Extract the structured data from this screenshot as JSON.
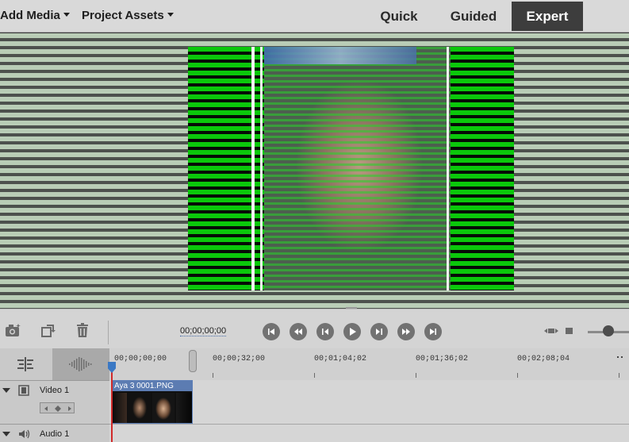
{
  "header": {
    "menus": [
      {
        "label": "Add Media"
      },
      {
        "label": "Project Assets"
      }
    ],
    "modes": [
      {
        "label": "Quick",
        "active": false
      },
      {
        "label": "Guided",
        "active": false
      },
      {
        "label": "Expert",
        "active": true
      }
    ]
  },
  "controls": {
    "timecode": "00;00;00;00",
    "transport_icons": [
      "go-to-start-icon",
      "rewind-icon",
      "step-back-icon",
      "play-icon",
      "step-forward-icon",
      "fast-forward-icon",
      "go-to-end-icon"
    ]
  },
  "timeline": {
    "ruler_labels": [
      "00;00;00;00",
      "00;00;32;00",
      "00;01;04;02",
      "00;01;36;02",
      "00;02;08;04"
    ],
    "tracks": [
      {
        "label": "Video 1"
      },
      {
        "label": "Audio 1"
      }
    ],
    "clip": {
      "name": "Aya 3 0001.PNG"
    }
  },
  "colors": {
    "accent": "#5c7cb2",
    "playhead": "#d12a2a",
    "active_mode_bg": "#3d3d3d"
  }
}
